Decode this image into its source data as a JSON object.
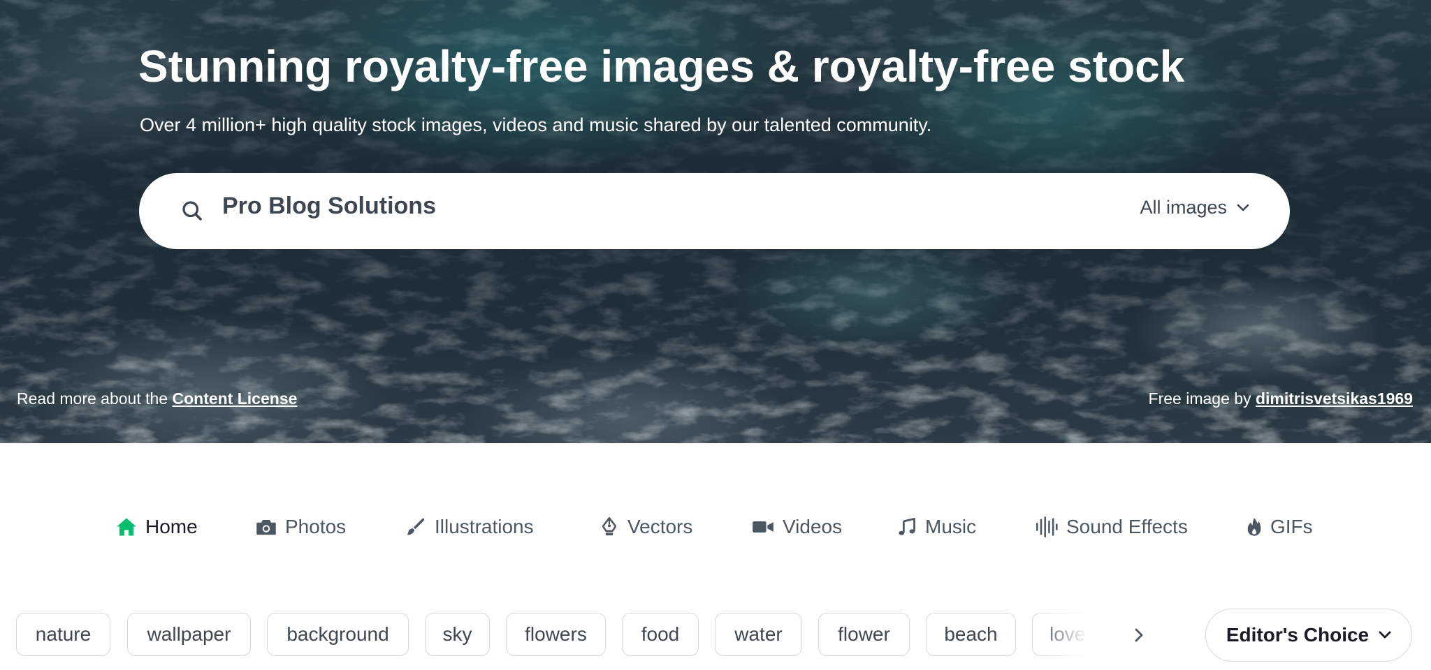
{
  "hero": {
    "title": "Stunning royalty-free images & royalty-free stock",
    "subtitle": "Over 4 million+ high quality stock images, videos and music shared by our talented community.",
    "license_prefix": "Read more about the ",
    "license_link": "Content License",
    "credit_prefix": "Free image by ",
    "credit_link": "dimitrisvetsikas1969"
  },
  "search": {
    "value": "Pro Blog Solutions",
    "type_selected": "All images"
  },
  "nav": {
    "items": [
      {
        "label": "Home",
        "icon": "home-icon",
        "active": true
      },
      {
        "label": "Photos",
        "icon": "camera-icon"
      },
      {
        "label": "Illustrations",
        "icon": "brush-icon"
      },
      {
        "label": "Vectors",
        "icon": "pen-nib-icon"
      },
      {
        "label": "Videos",
        "icon": "video-camera-icon"
      },
      {
        "label": "Music",
        "icon": "music-note-icon"
      },
      {
        "label": "Sound Effects",
        "icon": "waveform-icon"
      },
      {
        "label": "GIFs",
        "icon": "flame-icon"
      }
    ]
  },
  "tags": [
    "nature",
    "wallpaper",
    "background",
    "sky",
    "flowers",
    "food",
    "water",
    "flower",
    "beach",
    "love"
  ],
  "sort": {
    "selected": "Editor's Choice"
  },
  "colors": {
    "accent_green": "#02be6e",
    "text_dark": "#191b26",
    "text_muted": "#4d5762"
  }
}
